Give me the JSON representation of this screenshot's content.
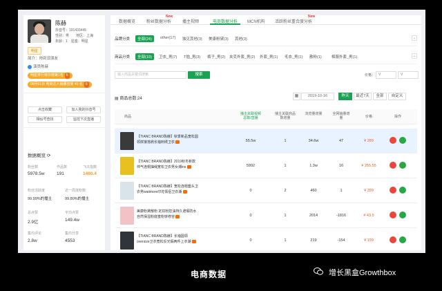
{
  "profile": {
    "name": "陈赫",
    "douyin_id": "抖音号：191433445",
    "gender_region": "性别：男　　地区：上海",
    "age_constellation": "年龄：1　星座：明星",
    "tag": "明星",
    "bio": "简介：帅到没朋友",
    "verified": "演员陈赫",
    "pill1": {
      "text": "明星排行榜日榜第1名",
      "badge": "6"
    },
    "pill2": {
      "text": "09月01日 电商达人销量榜第 40 名",
      "badge": "6"
    },
    "actions": [
      "点击收藏",
      "加入我的抖音号",
      "相似号查找",
      "监控下次直播"
    ],
    "overview_title": "数据概览",
    "stats": [
      {
        "label": "粉丝数",
        "value": "5978.5w",
        "highlight": false
      },
      {
        "label": "作品数",
        "value": "191",
        "highlight": false
      },
      {
        "label": "飞瓜指数",
        "value": "1460.4",
        "highlight": true
      },
      {
        "label": "粉丝活跃度",
        "value": "99.99%的播主",
        "highlight": false
      },
      {
        "label": "近一周涨粉数",
        "value": "99.80%的播主",
        "highlight": false
      },
      {
        "label": "总点赞",
        "value": "2.9亿",
        "highlight": false
      },
      {
        "label": "平均点赞",
        "value": "149.4w",
        "highlight": false
      },
      {
        "label": "集均评论",
        "value": "2.8w",
        "highlight": false
      },
      {
        "label": "集均分享",
        "value": "4553",
        "highlight": false
      }
    ]
  },
  "tabs": [
    {
      "label": "数据概览",
      "active": false,
      "new": false
    },
    {
      "label": "粉丝数据分析",
      "active": false,
      "new": true
    },
    {
      "label": "播主视频",
      "active": false,
      "new": false
    },
    {
      "label": "电商数据分析",
      "active": true,
      "new": false
    },
    {
      "label": "MCN机构",
      "active": false,
      "new": false
    },
    {
      "label": "活跃粉丝重合度分析",
      "active": false,
      "new": true
    }
  ],
  "new_label": "New",
  "brand_filter": {
    "label": "品牌分类",
    "items": [
      "全部(24)",
      "other(17)",
      "独见其他(3)",
      "美康粉黛(3)",
      "其他(3)"
    ]
  },
  "product_filter": {
    "label": "商品分类",
    "items": [
      "全部(19)",
      "卫衣_男(7)",
      "T恤_男(3)",
      "裤子_男(2)",
      "夹克外套_男(2)",
      "外套_男(1)",
      "毛衣_男(1)",
      "散粉(1)",
      "棉服外套_男(1)"
    ]
  },
  "search": {
    "placeholder": "输入商品关键词搜索",
    "button": "搜索"
  },
  "price": {
    "label": "价格：",
    "min": "V",
    "max": "V"
  },
  "total": "商品总数:24",
  "date": {
    "value": "2019-10-16",
    "buttons": [
      "昨天",
      "最近7天",
      "全部",
      "自定义"
    ]
  },
  "table": {
    "headers": [
      "商品",
      "播主关联视频总数/直播",
      "播主关联商品数增量",
      "浏览量增量",
      "全网销量增量",
      "价格",
      "操作"
    ],
    "rows": [
      {
        "title": "【TIANC BRAND陈赫】秋季新品宽松圆领拼接落肩长袖刺绣卫衣",
        "videos": "55.5w",
        "count": "1",
        "views": "34.6w",
        "sales": "47",
        "price": "¥ 289",
        "thumb": "#3a3a3a",
        "highlight": true
      },
      {
        "title": "【TIANC BRAND陈赫】2019秋冬新款帅气连帽抽绳宽松卫衣男女潮ins",
        "videos": "5992",
        "count": "1",
        "views": "1.3w",
        "sales": "16",
        "price": "¥ 255.55",
        "thumb": "#e8c020",
        "highlight": false
      },
      {
        "title": "【TIANC BRAND陈赫】宽松连帽套头卫衣男waitmore印花情侣卫衣潮",
        "videos": "0",
        "count": "2",
        "views": "460",
        "sales": "1",
        "price": "¥ 399",
        "thumb": "#d9e4ea",
        "highlight": false
      },
      {
        "title": "美康粉黛散粉 定妆粉控油持久遮瑕防水自然保湿粉底蜜粉饼修容",
        "videos": "0",
        "count": "1",
        "views": "2014",
        "sales": "-1816",
        "price": "¥ 43.5",
        "thumb": "#f2c2c6",
        "highlight": false
      },
      {
        "title": "【TIANC BRAND陈赫】长袖圆领oversize卫衣宽松反光假两件上衣潮",
        "videos": "0",
        "count": "1",
        "views": "219",
        "sales": "-154",
        "price": "¥ 199",
        "thumb": "#30353c",
        "highlight": false
      }
    ]
  },
  "caption": "电商数据",
  "brand": "增长黑盒Growthbox"
}
